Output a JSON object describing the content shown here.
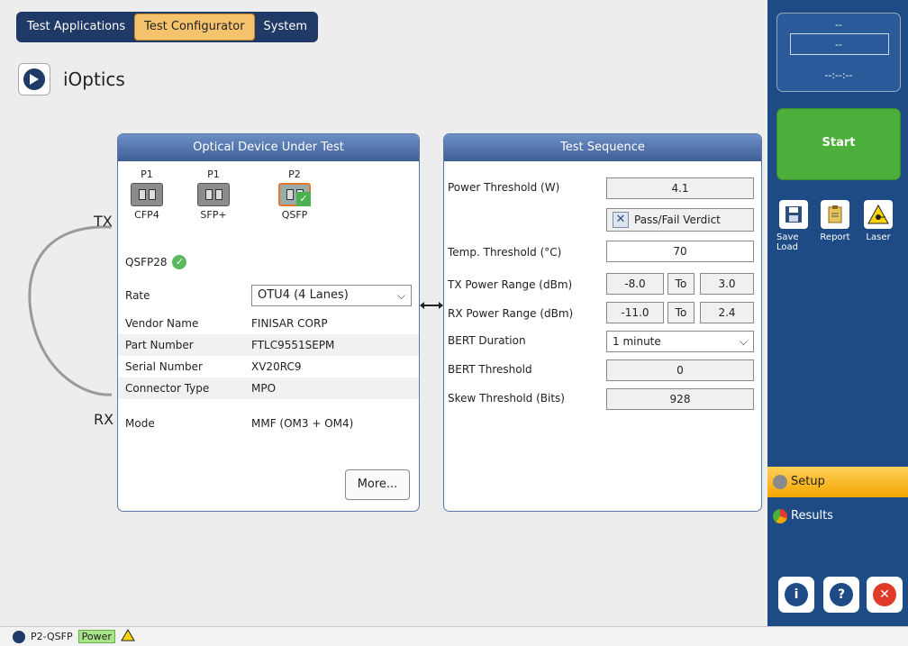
{
  "tabs": [
    "Test Applications",
    "Test Configurator",
    "System"
  ],
  "app": {
    "title": "iOptics"
  },
  "loop": {
    "tx": "TX",
    "rx": "RX"
  },
  "device_panel": {
    "title": "Optical Device Under Test",
    "ports": [
      {
        "group": "P1",
        "name": "CFP4"
      },
      {
        "group": "P1",
        "name": "SFP+"
      },
      {
        "group": "P2",
        "name": "QSFP"
      }
    ],
    "module": "QSFP28",
    "rate_label": "Rate",
    "rate_value": "OTU4 (4 Lanes)",
    "vendor_label": "Vendor Name",
    "vendor_value": "FINISAR CORP",
    "part_label": "Part Number",
    "part_value": "FTLC9551SEPM",
    "serial_label": "Serial Number",
    "serial_value": "XV20RC9",
    "connector_label": "Connector Type",
    "connector_value": "MPO",
    "mode_label": "Mode",
    "mode_value": "MMF (OM3 + OM4)",
    "more_label": "More..."
  },
  "test_sequence": {
    "title": "Test Sequence",
    "power_label": "Power Threshold (W)",
    "power_value": "4.1",
    "verdict_label": "Pass/Fail Verdict",
    "temp_label": "Temp. Threshold (°C)",
    "temp_value": "70",
    "tx_label": "TX Power Range (dBm)",
    "tx_min": "-8.0",
    "tx_max": "3.0",
    "rx_label": "RX Power Range (dBm)",
    "rx_min": "-11.0",
    "rx_max": "2.4",
    "to_label": "To",
    "bert_dur_label": "BERT Duration",
    "bert_dur_value": "1 minute",
    "bert_thr_label": "BERT Threshold",
    "bert_thr_value": "0",
    "skew_label": "Skew Threshold (Bits)",
    "skew_value": "928"
  },
  "side": {
    "clock_top": "--",
    "clock_mid": "--",
    "clock_bottom": "--:--:--",
    "start": "Start",
    "save": "Save",
    "load": "Load",
    "report": "Report",
    "laser": "Laser",
    "setup": "Setup",
    "results": "Results"
  },
  "status": {
    "port": "P2-QSFP",
    "power": "Power"
  },
  "colors": {
    "accent": "#f5a700",
    "side_bg": "#1e4b86",
    "start_green": "#4caf3c",
    "exit_red": "#e03a2a"
  }
}
